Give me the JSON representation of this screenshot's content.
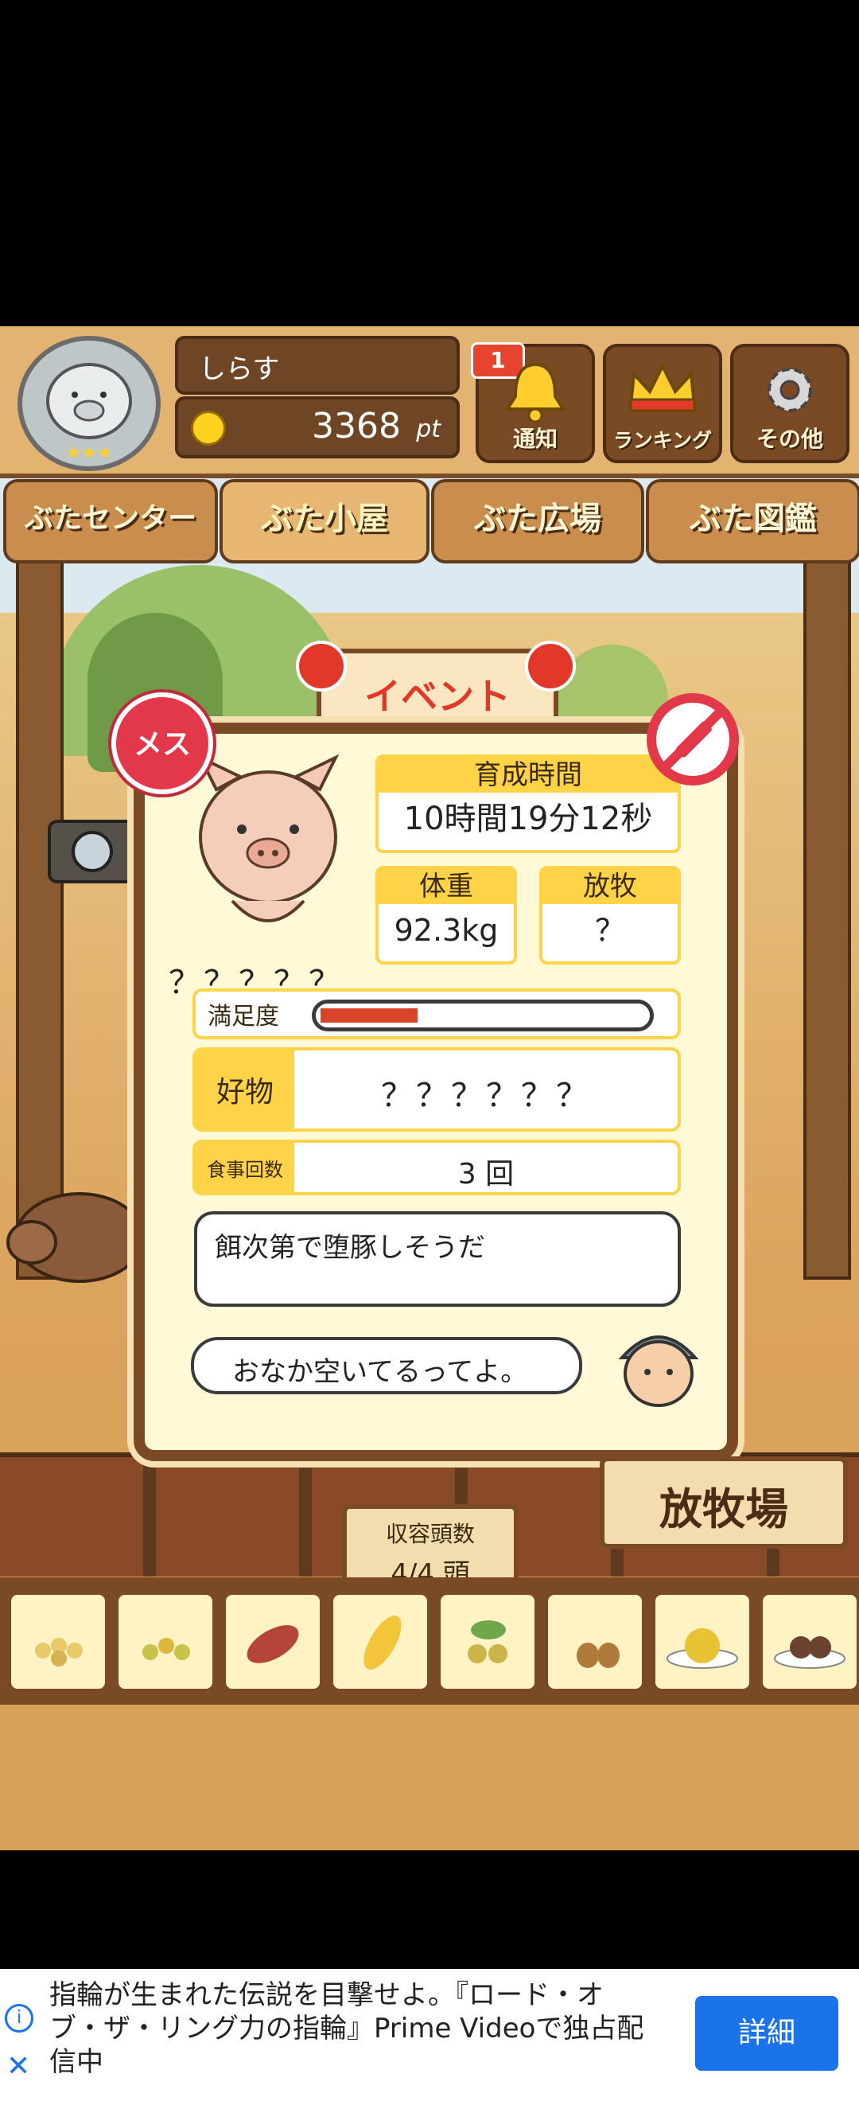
{
  "header": {
    "user_name": "しらす",
    "points_value": "3368",
    "points_unit": "pt",
    "notification_count": "1",
    "buttons": {
      "notice": "通知",
      "ranking": "ランキング",
      "other": "その他"
    }
  },
  "nav": {
    "tabs": [
      "ぶたセンター",
      "ぶた小屋",
      "ぶた広場",
      "ぶた図鑑"
    ],
    "active": "ぶた小屋"
  },
  "scene": {
    "event_sign": "イベント",
    "pasture_sign": "放牧場",
    "capacity_label": "収容頭数",
    "capacity_value": "4/4 頭"
  },
  "pig_card": {
    "gender_badge": "メス",
    "pig_name": "？？？？？",
    "raising_time_label": "育成時間",
    "raising_time_value": "10時間19分12秒",
    "weight_label": "体重",
    "weight_value": "92.3kg",
    "grazing_label": "放牧",
    "grazing_value": "？",
    "satisfaction_label": "満足度",
    "satisfaction_level": 0.3,
    "favorite_label": "好物",
    "favorite_value": "？？？？？？",
    "meals_label": "食事回数",
    "meals_value": "3 回",
    "comment_text": "餌次第で堕豚しそうだ",
    "farmer_text": "おなか空いてるってよ。"
  },
  "ad": {
    "text": "指輪が生まれた伝説を目撃せよ。『ロード・オブ・ザ・リング力の指輪』Prime Videoで独占配信中",
    "button": "詳細",
    "colors": {
      "button": "#1a73e8"
    }
  },
  "colors": {
    "accent": "#ffd348",
    "wood_dark": "#7a4a25",
    "bar": "#d9432a"
  }
}
